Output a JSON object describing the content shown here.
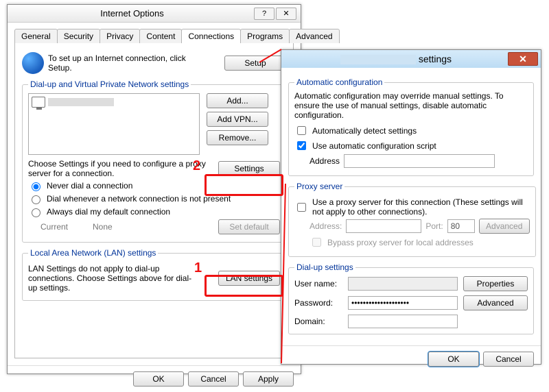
{
  "left": {
    "title": "Internet Options",
    "help": "?",
    "close": "✕",
    "tabs": [
      "General",
      "Security",
      "Privacy",
      "Content",
      "Connections",
      "Programs",
      "Advanced"
    ],
    "active_tab": 4,
    "setup_hint": "To set up an Internet connection, click Setup.",
    "setup_btn": "Setup",
    "dialup_legend": "Dial-up and Virtual Private Network settings",
    "list_item": "",
    "add_btn": "Add...",
    "addvpn_btn": "Add VPN...",
    "remove_btn": "Remove...",
    "choose_text": "Choose Settings if you need to configure a proxy server for a connection.",
    "settings_btn": "Settings",
    "radio_never": "Never dial a connection",
    "radio_when": "Dial whenever a network connection is not present",
    "radio_always": "Always dial my default connection",
    "current_label": "Current",
    "none_label": "None",
    "setdefault_btn": "Set default",
    "lan_legend": "Local Area Network (LAN) settings",
    "lan_text": "LAN Settings do not apply to dial-up connections. Choose Settings above for dial-up settings.",
    "lan_btn": "LAN settings",
    "ok": "OK",
    "cancel": "Cancel",
    "apply": "Apply"
  },
  "right": {
    "title_suffix": "settings",
    "close": "✕",
    "auto_legend": "Automatic configuration",
    "auto_text": "Automatic configuration may override manual settings.  To ensure the use of manual settings, disable automatic configuration.",
    "auto_detect": "Automatically detect settings",
    "use_script": "Use automatic configuration script",
    "address_label": "Address",
    "address_value": "",
    "proxy_legend": "Proxy server",
    "use_proxy": "Use a proxy server for this connection (These settings will not apply to other connections).",
    "proxy_addr_label": "Address:",
    "proxy_addr_value": "",
    "port_label": "Port:",
    "port_value": "80",
    "advanced_btn": "Advanced",
    "bypass": "Bypass proxy server for local addresses",
    "dial_legend": "Dial-up settings",
    "user_label": "User name:",
    "user_value": "",
    "properties_btn": "Properties",
    "pass_label": "Password:",
    "pass_value": "••••••••••••••••••••",
    "advanced2_btn": "Advanced",
    "domain_label": "Domain:",
    "domain_value": "",
    "ok": "OK",
    "cancel": "Cancel"
  },
  "annotations": {
    "num1": "1",
    "num2": "2"
  }
}
